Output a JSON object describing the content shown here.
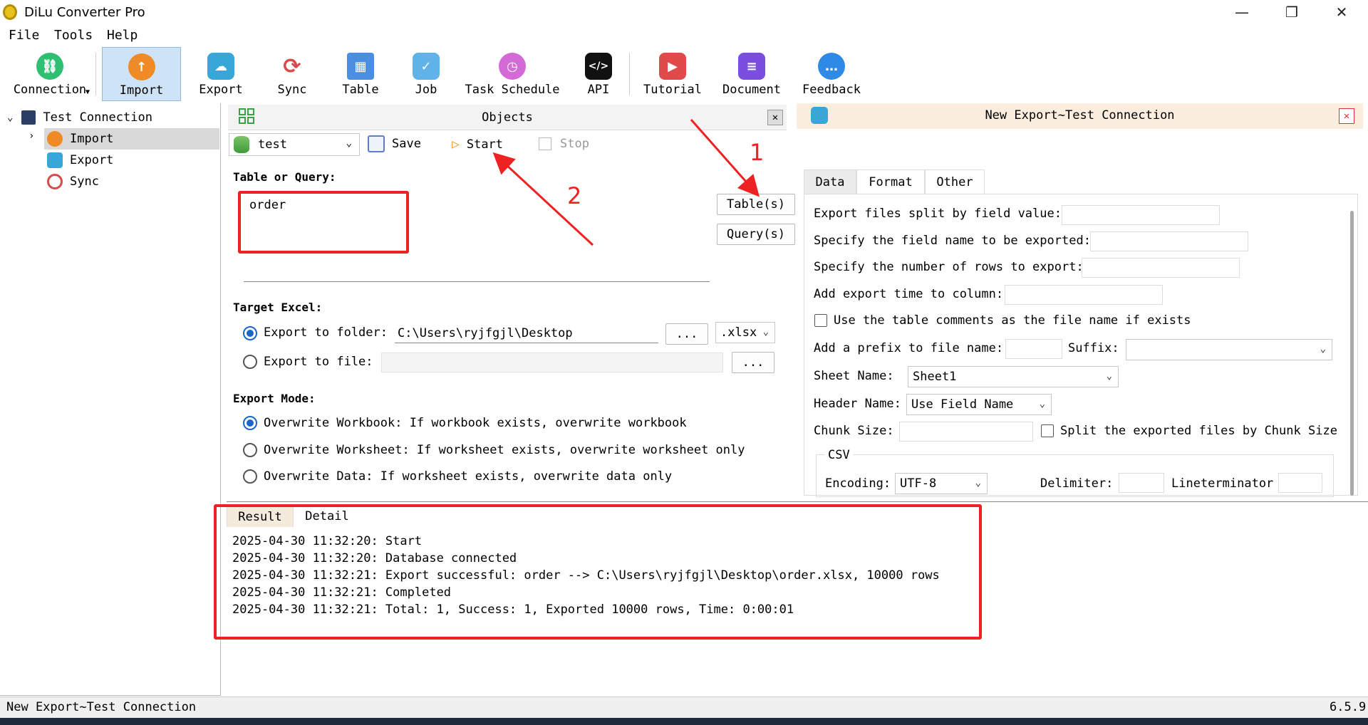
{
  "window": {
    "title": "DiLu Converter Pro",
    "minimize": "—",
    "maximize": "❐",
    "close": "✕"
  },
  "menu": [
    "File",
    "Tools",
    "Help"
  ],
  "toolbar": [
    {
      "label": "Connection",
      "icon": "link-icon",
      "color": "#2fbf71"
    },
    {
      "label": "Import",
      "icon": "import-cloud-icon",
      "color": "#f08a24"
    },
    {
      "label": "Export",
      "icon": "export-cloud-icon",
      "color": "#36a7d8"
    },
    {
      "label": "Sync",
      "icon": "sync-icon",
      "color": "#d84b4b"
    },
    {
      "label": "Table",
      "icon": "table-icon",
      "color": "#4a8fe0"
    },
    {
      "label": "Job",
      "icon": "job-icon",
      "color": "#5fb3e8"
    },
    {
      "label": "Task Schedule",
      "icon": "clock-icon",
      "color": "#d46ad6"
    },
    {
      "label": "API",
      "icon": "api-icon",
      "color": "#111111"
    },
    {
      "label": "Tutorial",
      "icon": "book-icon",
      "color": "#e04a4a"
    },
    {
      "label": "Document",
      "icon": "document-icon",
      "color": "#7b4ee0"
    },
    {
      "label": "Feedback",
      "icon": "chat-icon",
      "color": "#2e8ae6"
    }
  ],
  "tree": {
    "root": "Test Connection",
    "items": [
      "Import",
      "Export",
      "Sync"
    ]
  },
  "objects": {
    "title": "Objects",
    "close": "✕",
    "db": "test",
    "save": "Save",
    "start": "Start",
    "stop": "Stop",
    "table_or_query_label": "Table or Query:",
    "query_text": "order",
    "tables_btn": "Table(s)",
    "queries_btn": "Query(s)",
    "target_excel_label": "Target Excel:",
    "export_to_folder_label": "Export to folder:",
    "folder_path": "C:\\Users\\ryjfgjl\\Desktop",
    "browse": "...",
    "extension": ".xlsx",
    "export_to_file_label": "Export to file:",
    "file_path": "",
    "export_mode_label": "Export Mode:",
    "modes": [
      "Overwrite Workbook: If workbook exists, overwrite workbook",
      "Overwrite Worksheet: If worksheet exists, overwrite worksheet only",
      "Overwrite Data: If worksheet exists, overwrite data only"
    ]
  },
  "export_panel": {
    "title": "New Export~Test Connection",
    "close": "✕",
    "tabs": [
      "Data",
      "Format",
      "Other"
    ],
    "split_label": "Export files split by field value:",
    "field_name_label": "Specify the field name to be exported:",
    "rows_label": "Specify the number of rows to export:",
    "time_col_label": "Add export time to column:",
    "use_comments_label": "Use the table comments as the file name if exists",
    "prefix_label": "Add a prefix to file name:",
    "suffix_label": "Suffix:",
    "sheet_name_label": "Sheet Name:",
    "sheet_name_value": "Sheet1",
    "header_name_label": "Header Name:",
    "header_name_value": "Use Field Name",
    "chunk_size_label": "Chunk Size:",
    "split_chunk_label": "Split the exported files by Chunk Size",
    "csv_label": "CSV",
    "encoding_label": "Encoding:",
    "encoding_value": "UTF-8",
    "delimiter_label": "Delimiter:",
    "lineterminator_label": "Lineterminator"
  },
  "result": {
    "tabs": [
      "Result",
      "Detail"
    ],
    "lines": [
      "2025-04-30 11:32:20: Start",
      "2025-04-30 11:32:20: Database connected",
      "2025-04-30 11:32:21: Export successful: order --> C:\\Users\\ryjfgjl\\Desktop\\order.xlsx, 10000 rows",
      "2025-04-30 11:32:21: Completed",
      "2025-04-30 11:32:21: Total: 1, Success: 1, Exported 10000 rows, Time: 0:00:01"
    ]
  },
  "status": {
    "left": "New Export~Test Connection",
    "version": "6.5.9"
  },
  "annotations": {
    "step1": "1",
    "step2": "2",
    "color": "#ee2222"
  }
}
